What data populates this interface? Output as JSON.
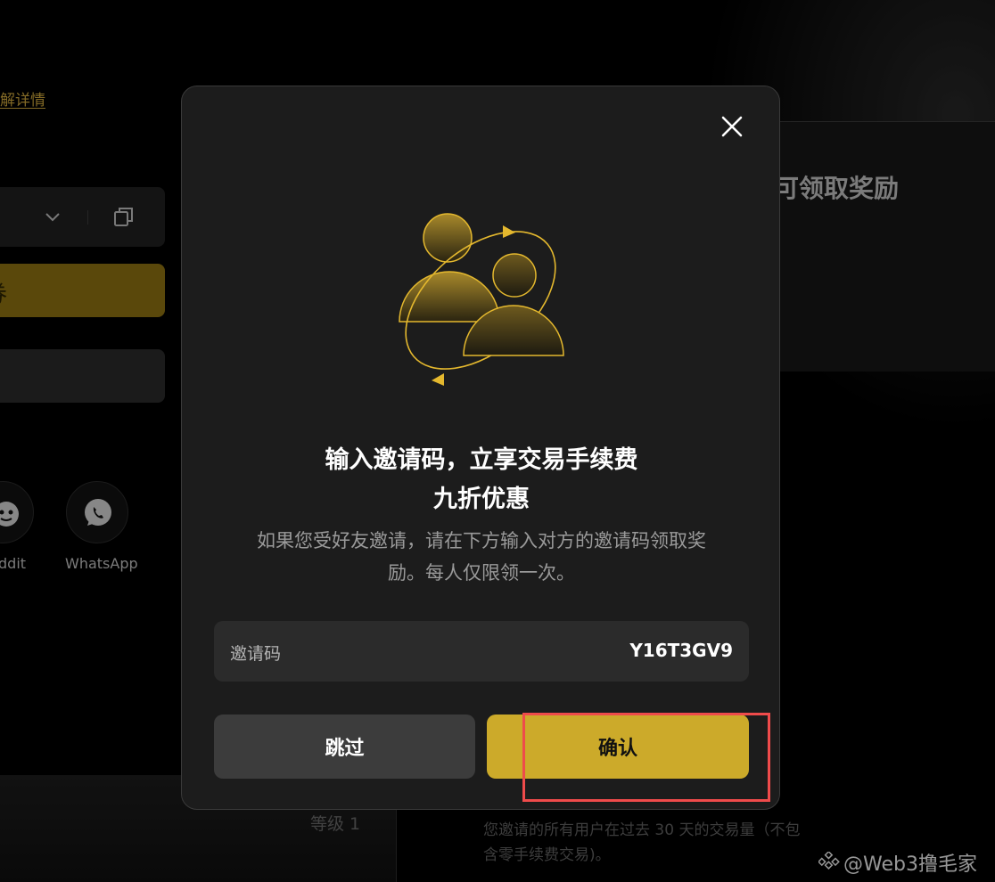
{
  "background": {
    "learn_more_link": "解详情",
    "share_options": [
      {
        "label": "ddit",
        "icon": "reddit-icon"
      },
      {
        "label": "WhatsApp",
        "icon": "whatsapp-icon"
      }
    ],
    "right_panel_title": "可领取奖励",
    "level_label": "等级 1",
    "volume_description": "您邀请的所有用户在过去 30 天的交易量（不包含零手续费交易)。",
    "watermark": "@Web3撸毛家"
  },
  "modal": {
    "title_line1": "输入邀请码，立享交易手续费",
    "title_line2": "九折优惠",
    "description_line1": "如果您受好友邀请，请在下方输入对方的邀请码领取奖",
    "description_line2": "励。每人仅限领一次。",
    "invite_code": {
      "label": "邀请码",
      "value": "Y16T3GV9"
    },
    "skip_label": "跳过",
    "confirm_label": "确认"
  },
  "colors": {
    "accent_gold": "#ccaa2a",
    "highlight_red": "#ef4b4b",
    "modal_bg": "#1c1c1c"
  }
}
